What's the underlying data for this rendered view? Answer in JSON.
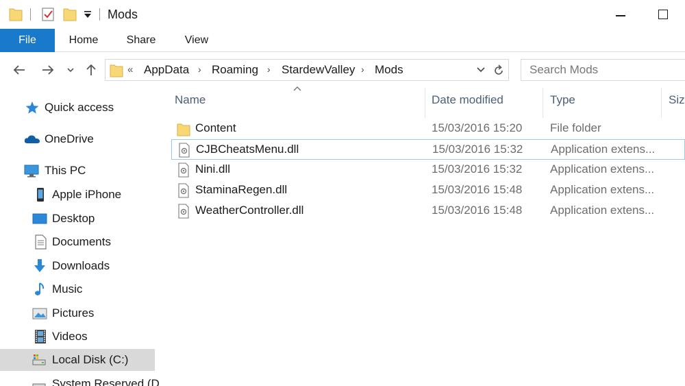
{
  "window": {
    "title": "Mods",
    "accent_color": "#1979ca"
  },
  "quick_access_toolbar": {
    "icons": [
      "folder-icon",
      "properties-check-icon",
      "new-folder-icon",
      "customize-dropdown-icon"
    ]
  },
  "ribbon": {
    "tabs": [
      {
        "label": "File"
      },
      {
        "label": "Home"
      },
      {
        "label": "Share"
      },
      {
        "label": "View"
      }
    ]
  },
  "address_bar": {
    "overflow_indicator": "«",
    "breadcrumbs": [
      "AppData",
      "Roaming",
      "StardewValley",
      "Mods"
    ],
    "separator": "›"
  },
  "search": {
    "placeholder": "Search Mods"
  },
  "sidebar": {
    "items": [
      {
        "label": "Quick access",
        "icon": "star-icon"
      },
      {
        "label": "OneDrive",
        "icon": "cloud-icon"
      },
      {
        "label": "This PC",
        "icon": "computer-icon"
      },
      {
        "label": "Apple iPhone",
        "icon": "phone-icon"
      },
      {
        "label": "Desktop",
        "icon": "desktop-icon"
      },
      {
        "label": "Documents",
        "icon": "documents-icon"
      },
      {
        "label": "Downloads",
        "icon": "download-arrow-icon"
      },
      {
        "label": "Music",
        "icon": "music-note-icon"
      },
      {
        "label": "Pictures",
        "icon": "pictures-icon"
      },
      {
        "label": "Videos",
        "icon": "film-icon"
      },
      {
        "label": "Local Disk (C:)",
        "icon": "drive-icon",
        "selected": true
      },
      {
        "label": "System Reserved (D",
        "icon": "drive-icon"
      }
    ]
  },
  "file_list": {
    "columns": [
      {
        "label": "Name",
        "sorted": "ascending"
      },
      {
        "label": "Date modified"
      },
      {
        "label": "Type"
      },
      {
        "label": "Size"
      }
    ],
    "rows": [
      {
        "name": "Content",
        "date": "15/03/2016 15:20",
        "type": "File folder",
        "icon": "folder-icon"
      },
      {
        "name": "CJBCheatsMenu.dll",
        "date": "15/03/2016 15:32",
        "type": "Application extens...",
        "icon": "dll-file-icon",
        "focused": true
      },
      {
        "name": "Nini.dll",
        "date": "15/03/2016 15:32",
        "type": "Application extens...",
        "icon": "dll-file-icon"
      },
      {
        "name": "StaminaRegen.dll",
        "date": "15/03/2016 15:48",
        "type": "Application extens...",
        "icon": "dll-file-icon"
      },
      {
        "name": "WeatherController.dll",
        "date": "15/03/2016 15:48",
        "type": "Application extens...",
        "icon": "dll-file-icon"
      }
    ]
  }
}
